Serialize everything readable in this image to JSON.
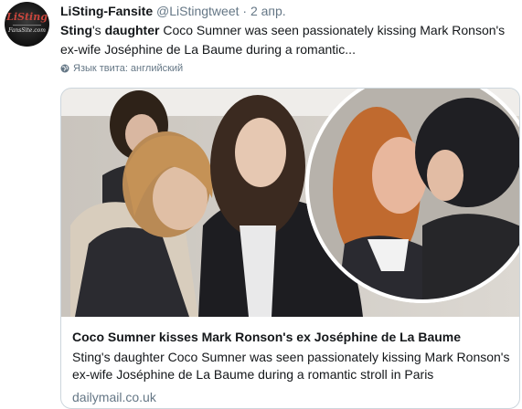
{
  "tweet": {
    "author_name": "LiSting-Fansite",
    "handle": "@LiStingtweet",
    "separator": "·",
    "time": "2 апр.",
    "text_highlight_1": "Sting",
    "text_part_1": "'s ",
    "text_highlight_2": "daughter",
    "text_part_2": " Coco Sumner was seen passionately kissing Mark Ronson's ex-wife Joséphine de La Baume during a romantic...",
    "language_label": "Язык твита: английский",
    "avatar": {
      "logo_top": "LiSting",
      "logo_bottom": "FansSite.com"
    }
  },
  "card": {
    "image_icon": "photo",
    "title": "Coco Sumner kisses Mark Ronson's ex Joséphine de La Baume",
    "description": "Sting's daughter Coco Sumner was seen passionately kissing Mark Ronson's ex-wife Joséphine de La Baume during a romantic stroll in Paris",
    "domain": "dailymail.co.uk"
  },
  "colors": {
    "text": "#14171a",
    "muted": "#657786",
    "border": "#ccd6dd",
    "logo_red": "#c8453c"
  }
}
